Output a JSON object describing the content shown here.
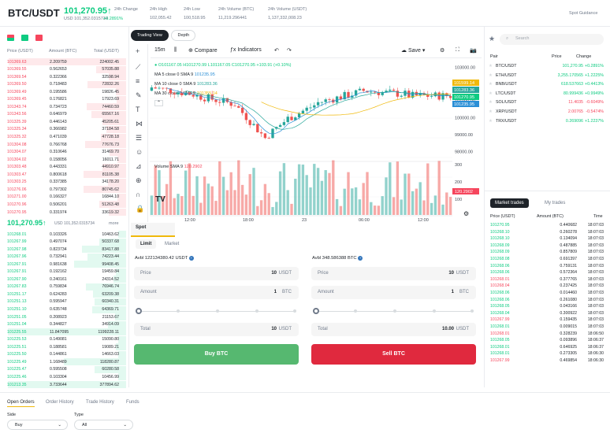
{
  "header": {
    "pair": "BTC/USDT",
    "price": "101,270.95",
    "arrow": "↑",
    "price_usd": "USD 101,352.0315734",
    "change_pct": "+0.2891%",
    "stats": [
      {
        "label": "24h Change",
        "value": ""
      },
      {
        "label": "24h High",
        "value": "102,055.42"
      },
      {
        "label": "24h Low",
        "value": "100,518.95"
      },
      {
        "label": "24h Volume (BTC)",
        "value": "11,219.296441"
      },
      {
        "label": "24h Volume (USDT)",
        "value": "1,137,332,008.23"
      }
    ],
    "spot_guidance": "Spot Guidance"
  },
  "orderbook": {
    "headers": {
      "price": "Price (USDT)",
      "amount": "Amount (BTC)",
      "total": "Total (USDT)"
    },
    "asks": [
      [
        "101369.63",
        "2.209759",
        "224002.45"
      ],
      [
        "101369.55",
        "0.562653",
        "57035.88"
      ],
      [
        "101369.54",
        "0.322366",
        "32598.94"
      ],
      [
        "101369.50",
        "0.718483",
        "72832.26"
      ],
      [
        "101369.49",
        "0.195586",
        "19826.45"
      ],
      [
        "101369.45",
        "0.176821",
        "17923.69"
      ],
      [
        "101343.74",
        "0.734723",
        "74460.59"
      ],
      [
        "101343.56",
        "0.646979",
        "65567.16"
      ],
      [
        "101325.39",
        "0.446143",
        "45205.61"
      ],
      [
        "101325.34",
        "0.366982",
        "37184.58"
      ],
      [
        "101325.32",
        "0.471039",
        "47728.18"
      ],
      [
        "101304.08",
        "0.766768",
        "77676.73"
      ],
      [
        "101304.07",
        "0.310646",
        "31469.70"
      ],
      [
        "101304.02",
        "0.158056",
        "16011.71"
      ],
      [
        "101303.48",
        "0.443331",
        "44910.97"
      ],
      [
        "101303.47",
        "0.800618",
        "81105.38"
      ],
      [
        "101303.25",
        "0.337385",
        "34178.20"
      ],
      [
        "101276.06",
        "0.797302",
        "80745.62"
      ],
      [
        "101271.00",
        "0.166327",
        "16844.10"
      ],
      [
        "101270.96",
        "0.506201",
        "51263.48"
      ],
      [
        "101270.95",
        "0.331974",
        "33619.32"
      ]
    ],
    "mid_price": "101,270.95↑",
    "mid_usd": "USD 101,352.0315734",
    "more": "more",
    "bids": [
      [
        "101268.01",
        "0.103326",
        "10463.62"
      ],
      [
        "101267.99",
        "0.497074",
        "50337.68"
      ],
      [
        "101267.98",
        "0.823734",
        "83417.88"
      ],
      [
        "101267.96",
        "0.732941",
        "74223.44"
      ],
      [
        "101267.91",
        "0.981638",
        "99408.45"
      ],
      [
        "101267.91",
        "0.192162",
        "19459.84"
      ],
      [
        "101267.90",
        "0.240161",
        "24314.52"
      ],
      [
        "101267.83",
        "0.759834",
        "76946.74"
      ],
      [
        "101251.17",
        "0.624283",
        "63209.38"
      ],
      [
        "101251.13",
        "0.595947",
        "60340.31"
      ],
      [
        "101251.10",
        "0.635748",
        "64369.71"
      ],
      [
        "101251.05",
        "0.208923",
        "21153.67"
      ],
      [
        "101251.04",
        "0.344827",
        "34914.09"
      ],
      [
        "101225.55",
        "11.847095",
        "1199228.11"
      ],
      [
        "101225.53",
        "0.149081",
        "15090.80"
      ],
      [
        "101225.51",
        "0.188581",
        "19089.21"
      ],
      [
        "101225.50",
        "0.144861",
        "14663.03"
      ],
      [
        "101225.49",
        "1.168489",
        "118280.87"
      ],
      [
        "101225.47",
        "0.595508",
        "60280.58"
      ],
      [
        "101225.46",
        "0.103304",
        "10456.99"
      ],
      [
        "101213.35",
        "3.733644",
        "377894.62"
      ]
    ]
  },
  "chart": {
    "tabs": [
      "Trading View",
      "Depth"
    ],
    "interval": "15m",
    "compare": "Compare",
    "indicators": "Indicators",
    "save": "Save",
    "ohlc": "O101167.05 H101270.99 L101167.05 C101270.95 +103.91 (+0.10%)",
    "ma": [
      {
        "label": "MA 5 close 0 SMA 9",
        "value": "101235.95",
        "color": "#2b8fd6"
      },
      {
        "label": "MA 10 close 0 SMA 9",
        "value": "101283.36",
        "color": "#26a69a"
      },
      {
        "label": "MA 30 close 0 SMA 9",
        "value": "101355.14",
        "color": "#f0b90b"
      }
    ],
    "price_ticks": [
      "103000.00",
      "102000.00",
      "101000.00",
      "100000.00",
      "99000.00",
      "98000.00"
    ],
    "price_tags": [
      {
        "value": "101599.14",
        "color": "#f0b90b"
      },
      {
        "value": "101283.36",
        "color": "#26a69a"
      },
      {
        "value": "101270.95",
        "color": "#0ecb81"
      },
      {
        "value": "101235.95",
        "color": "#2b8fd6"
      }
    ],
    "volume_label": "Volume SMA 9",
    "volume_sma": "120.2902",
    "volume_ticks": [
      "300",
      "200",
      "100"
    ],
    "volume_tag": "120.2902",
    "time_ticks": [
      "12:00",
      "18:00",
      "23",
      "06:00",
      "12:00"
    ]
  },
  "order_form": {
    "tab": "Spot",
    "types": [
      "Limit",
      "Market"
    ],
    "buy": {
      "avbl": "Avbl 122134380.42 USDT",
      "price_label": "Price",
      "price": "10",
      "price_unit": "USDT",
      "amount_label": "Amount",
      "amount": "1",
      "amount_unit": "BTC",
      "total_label": "Total",
      "total": "10",
      "total_unit": "USDT",
      "button": "Buy BTC"
    },
    "sell": {
      "avbl": "Avbl 348.586388 BTC",
      "price_label": "Price",
      "price": "10",
      "price_unit": "USDT",
      "amount_label": "Amount",
      "amount": "1",
      "amount_unit": "BTC",
      "total_label": "Total",
      "total": "10.00",
      "total_unit": "USDT",
      "button": "Sell BTC"
    }
  },
  "markets": {
    "search_placeholder": "Search",
    "headers": {
      "pair": "Pair",
      "price": "Price",
      "change": "Change"
    },
    "rows": [
      [
        "BTC/USDT",
        "101,270.95",
        "+0.2891%"
      ],
      [
        "ETH/USDT",
        "3,255.170565",
        "+1.2225%"
      ],
      [
        "BNB/USDT",
        "618.537663",
        "+0.4413%"
      ],
      [
        "LTC/USDT",
        "80.999436",
        "+0.9949%"
      ],
      [
        "SOL/USDT",
        "11.4035",
        "-0.6049%"
      ],
      [
        "XRP/USDT",
        "2.00765",
        "-0.5474%"
      ],
      [
        "TRX/USDT",
        "0.269096",
        "+1.2237%"
      ]
    ]
  },
  "trades": {
    "tabs": [
      "Market trades",
      "My trades"
    ],
    "headers": {
      "price": "Price (USDT)",
      "amount": "Amount (BTC)",
      "time": "Time"
    },
    "rows": [
      [
        "101270.95",
        "0.440682",
        "18:07:03"
      ],
      [
        "101268.10",
        "0.260278",
        "18:07:03"
      ],
      [
        "101268.10",
        "0.134094",
        "18:07:03"
      ],
      [
        "101268.09",
        "0.487885",
        "18:07:03"
      ],
      [
        "101268.09",
        "0.857809",
        "18:07:03"
      ],
      [
        "101268.08",
        "0.691397",
        "18:07:03"
      ],
      [
        "101268.06",
        "0.759131",
        "18:07:03"
      ],
      [
        "101268.06",
        "0.572364",
        "18:07:03"
      ],
      [
        "101268.01",
        "0.377765",
        "18:07:03"
      ],
      [
        "101268.04",
        "0.237425",
        "18:07:03"
      ],
      [
        "101268.06",
        "0.014460",
        "18:07:03"
      ],
      [
        "101268.06",
        "0.261080",
        "18:07:03"
      ],
      [
        "101268.05",
        "0.043166",
        "18:07:03"
      ],
      [
        "101268.04",
        "0.300922",
        "18:07:03"
      ],
      [
        "101267.99",
        "0.159435",
        "18:07:03"
      ],
      [
        "101268.01",
        "0.009015",
        "18:07:03"
      ],
      [
        "101268.01",
        "0.328239",
        "18:06:50"
      ],
      [
        "101268.05",
        "0.093896",
        "18:06:37"
      ],
      [
        "101268.01",
        "0.646925",
        "18:06:37"
      ],
      [
        "101268.01",
        "0.273305",
        "18:06:30"
      ],
      [
        "101267.99",
        "0.469854",
        "18:06:30"
      ]
    ]
  },
  "bottom": {
    "tabs": [
      "Open Orders",
      "Order History",
      "Trade History",
      "Funds"
    ],
    "side_label": "Side",
    "side_value": "Buy",
    "type_label": "Type",
    "type_value": "All"
  },
  "colors": {
    "green": "#0ecb81",
    "red": "#f6465d",
    "accent": "#f0b90b"
  }
}
